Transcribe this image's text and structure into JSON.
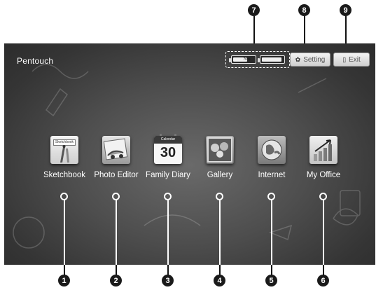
{
  "app": {
    "title": "Pentouch"
  },
  "status": {
    "battery1_percent": "70%",
    "battery2_percent": ""
  },
  "buttons": {
    "setting_label": "Setting",
    "exit_label": "Exit"
  },
  "apps": [
    {
      "label": "Sketchbook",
      "icon": "sketchbook-icon",
      "sub": "Sketchbook"
    },
    {
      "label": "Photo Editor",
      "icon": "photo-editor-icon"
    },
    {
      "label": "Family Diary",
      "icon": "calendar-icon",
      "calendar_header": "Calendar",
      "calendar_day": "30"
    },
    {
      "label": "Gallery",
      "icon": "gallery-icon"
    },
    {
      "label": "Internet",
      "icon": "globe-icon"
    },
    {
      "label": "My Office",
      "icon": "office-chart-icon"
    }
  ],
  "callouts": [
    "1",
    "2",
    "3",
    "4",
    "5",
    "6",
    "7",
    "8",
    "9"
  ]
}
